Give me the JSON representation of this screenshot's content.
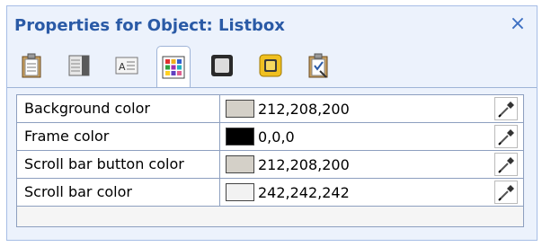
{
  "dialog": {
    "title": "Properties for Object: Listbox",
    "close_glyph": "×"
  },
  "tabs": [
    {
      "name": "clipboard-icon",
      "active": false
    },
    {
      "name": "layout-icon",
      "active": false
    },
    {
      "name": "text-icon",
      "active": false
    },
    {
      "name": "colors-icon",
      "active": true
    },
    {
      "name": "frame-icon",
      "active": false
    },
    {
      "name": "yellow-square-icon",
      "active": false
    },
    {
      "name": "events-icon",
      "active": false
    }
  ],
  "properties": [
    {
      "label": "Background color",
      "value": "212,208,200",
      "swatch": "#d4d0c8"
    },
    {
      "label": "Frame color",
      "value": "0,0,0",
      "swatch": "#000000"
    },
    {
      "label": "Scroll bar button color",
      "value": "212,208,200",
      "swatch": "#d4d0c8"
    },
    {
      "label": "Scroll bar color",
      "value": "242,242,242",
      "swatch": "#f2f2f2"
    }
  ],
  "colors": {
    "title": "#2a5aa6",
    "panel_bg": "#ecf2fc",
    "border": "#8d9fbf"
  }
}
